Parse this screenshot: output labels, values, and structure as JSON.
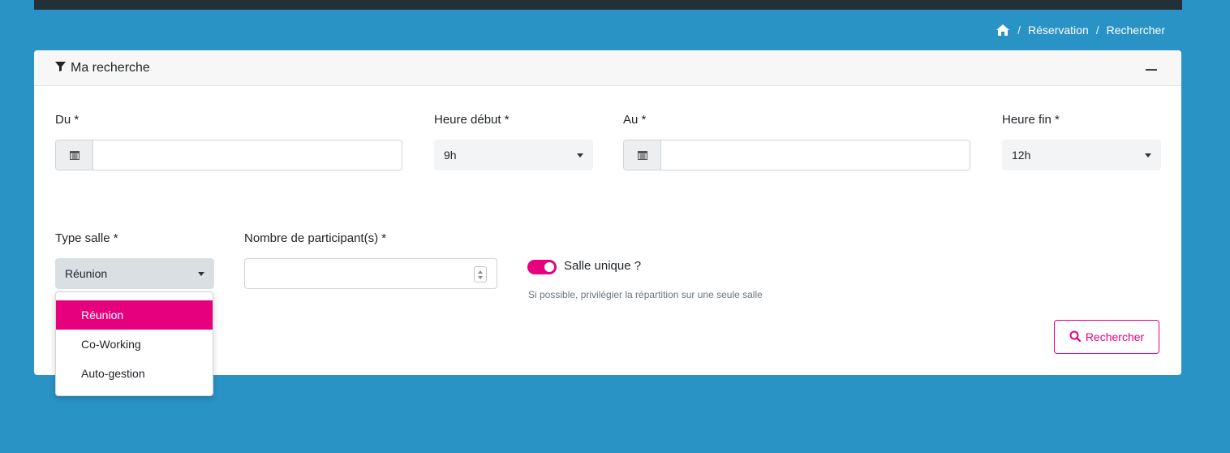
{
  "breadcrumb": {
    "home_icon": "home-icon",
    "separator": "/",
    "items": [
      "Réservation",
      "Rechercher"
    ]
  },
  "panel": {
    "title": "Ma recherche",
    "filter_icon": "filter-icon",
    "collapse_icon": "minus-icon"
  },
  "form": {
    "date_from": {
      "label": "Du *",
      "value": "",
      "icon": "calendar-icon"
    },
    "start_hour": {
      "label": "Heure début *",
      "value": "9h"
    },
    "date_to": {
      "label": "Au *",
      "value": "",
      "icon": "calendar-icon"
    },
    "end_hour": {
      "label": "Heure fin *",
      "value": "12h"
    },
    "room_type": {
      "label": "Type salle *",
      "value": "Réunion",
      "options": [
        "Réunion",
        "Co-Working",
        "Auto-gestion"
      ],
      "highlighted": "Réunion"
    },
    "participants": {
      "label": "Nombre de participant(s) *",
      "value": ""
    },
    "single_room": {
      "label": "Salle unique ?",
      "enabled": true,
      "hint": "Si possible, privilégier la répartition sur une seule salle"
    },
    "search_button": {
      "label": "Rechercher",
      "icon": "search-icon"
    }
  },
  "colors": {
    "background": "#2a93c6",
    "accent": "#e6007e",
    "topbar": "#243038"
  }
}
